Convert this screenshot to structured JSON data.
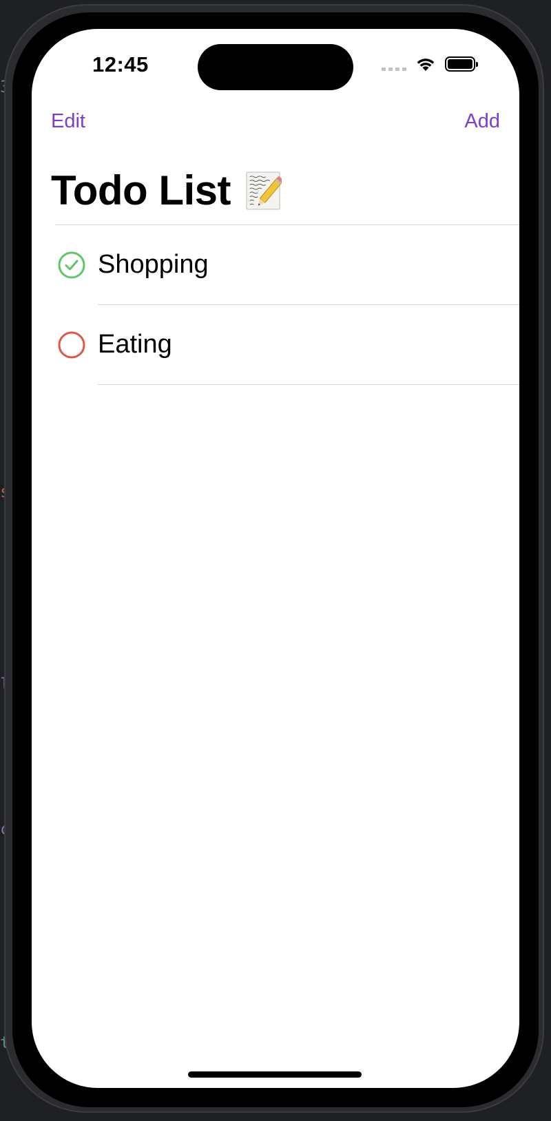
{
  "status_bar": {
    "time": "12:45"
  },
  "nav": {
    "edit_label": "Edit",
    "add_label": "Add"
  },
  "title": {
    "text": "Todo List",
    "emoji_icon": "memo-icon"
  },
  "todos": [
    {
      "label": "Shopping",
      "done": true,
      "icon": "checkmark-circle-icon",
      "color": "#62c466"
    },
    {
      "label": "Eating",
      "done": false,
      "icon": "empty-circle-icon",
      "color": "#e0574a"
    }
  ],
  "colors": {
    "accent": "#7b3fce",
    "done": "#62c466",
    "pending": "#e0574a"
  }
}
